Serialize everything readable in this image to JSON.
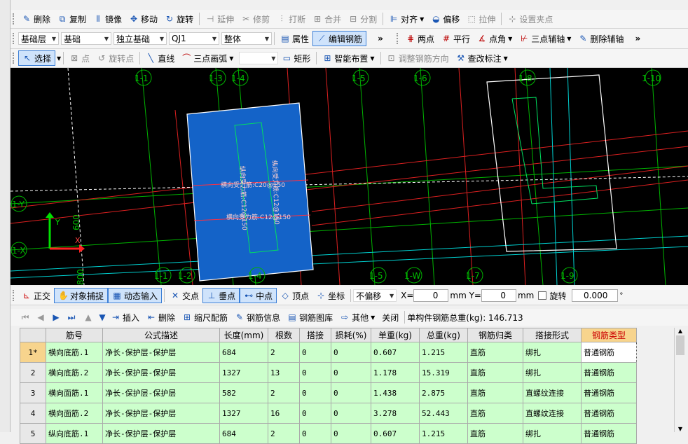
{
  "toolbar1": {
    "delete": "删除",
    "copy": "复制",
    "mirror": "镜像",
    "move": "移动",
    "rotate": "旋转",
    "extend": "延伸",
    "trim": "修剪",
    "break": "打断",
    "merge": "合并",
    "split": "分割",
    "align": "对齐",
    "offset": "偏移",
    "stretch": "拉伸",
    "set_grip": "设置夹点"
  },
  "toolbar2": {
    "layer": "基础层",
    "category": "基础",
    "type": "独立基础",
    "name": "QJ1",
    "part": "整体",
    "props": "属性",
    "edit_rebar": "编辑钢筋",
    "two_points": "两点",
    "parallel": "平行",
    "point_angle": "点角",
    "three_point_axis": "三点辅轴",
    "delete_axis": "删除辅轴"
  },
  "toolbar3": {
    "select": "选择",
    "point": "点",
    "rotate_point": "旋转点",
    "line": "直线",
    "arc": "三点画弧",
    "rect": "矩形",
    "smart": "智能布置",
    "adjust_dir": "调整钢筋方向",
    "check_label": "查改标注"
  },
  "axes": {
    "a1": "1-1",
    "a3": "1-3",
    "a4": "1-4",
    "a5": "1-5",
    "a6": "1-6",
    "a8": "1-8",
    "a10": "1-10",
    "aY": "1-Y",
    "aX": "1-X",
    "b1": "1-1",
    "b2": "1-2",
    "b4": "1-4",
    "b5": "1-5",
    "bW": "1-W",
    "b7": "1-7",
    "b9": "1-9",
    "dim1": "600",
    "dim2": "800",
    "ucsY": "Y",
    "ucsX": "X"
  },
  "rebar_labels": {
    "h1": "横向受力筋:C20@150",
    "h2": "横向受力筋:C12@150",
    "v1": "纵向受力筋:C12@150",
    "v2": "纵向受力筋:C12@150"
  },
  "status": {
    "ortho": "正交",
    "osnap": "对象捕捉",
    "dyn": "动态输入",
    "intersect": "交点",
    "perp": "垂点",
    "mid": "中点",
    "vertex": "顶点",
    "coord": "坐标",
    "offset": "不偏移",
    "x_label": "X=",
    "x_val": "0",
    "y_label": "mm Y=",
    "y_val": "0",
    "mm": "mm",
    "rotate": "旋转",
    "rot_val": "0.000"
  },
  "tablebar": {
    "insert": "插入",
    "delete": "删除",
    "scale": "缩尺配筋",
    "info": "钢筋信息",
    "lib": "钢筋图库",
    "other": "其他",
    "close": "关闭",
    "total": "单构件钢筋总重(kg): 146.713"
  },
  "headers": [
    "筋号",
    "公式描述",
    "长度(mm)",
    "根数",
    "搭接",
    "损耗(%)",
    "单重(kg)",
    "总重(kg)",
    "钢筋归类",
    "搭接形式",
    "钢筋类型"
  ],
  "rows": [
    {
      "idx": "1*",
      "c": [
        "横向底筋.1",
        "净长-保护层-保护层",
        "684",
        "2",
        "0",
        "0",
        "0.607",
        "1.215",
        "直筋",
        "绑扎",
        "普通钢筋"
      ]
    },
    {
      "idx": "2",
      "c": [
        "横向底筋.2",
        "净长-保护层-保护层",
        "1327",
        "13",
        "0",
        "0",
        "1.178",
        "15.319",
        "直筋",
        "绑扎",
        "普通钢筋"
      ]
    },
    {
      "idx": "3",
      "c": [
        "横向面筋.1",
        "净长-保护层-保护层",
        "582",
        "2",
        "0",
        "0",
        "1.438",
        "2.875",
        "直筋",
        "直螺纹连接",
        "普通钢筋"
      ]
    },
    {
      "idx": "4",
      "c": [
        "横向面筋.2",
        "净长-保护层-保护层",
        "1327",
        "16",
        "0",
        "0",
        "3.278",
        "52.443",
        "直筋",
        "直螺纹连接",
        "普通钢筋"
      ]
    },
    {
      "idx": "5",
      "c": [
        "纵向底筋.1",
        "净长-保护层-保护层",
        "684",
        "2",
        "0",
        "0",
        "0.607",
        "1.215",
        "直筋",
        "绑扎",
        "普通钢筋"
      ]
    }
  ]
}
